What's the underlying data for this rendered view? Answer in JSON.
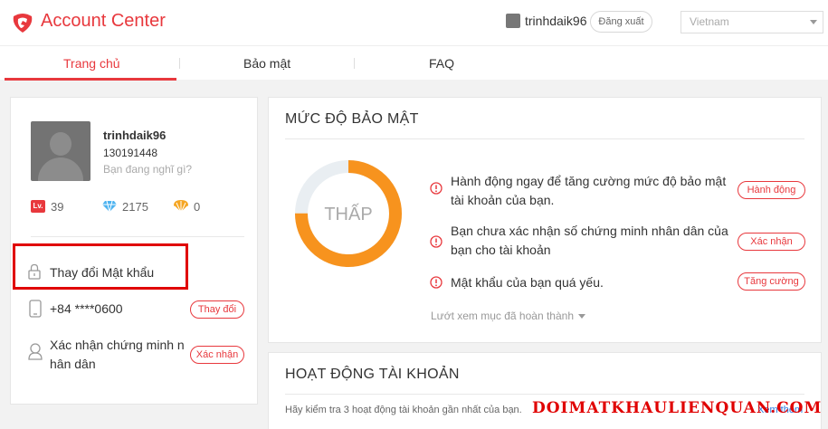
{
  "header": {
    "brand": "Account Center",
    "username": "trinhdaik96",
    "logout_label": "Đăng xuất",
    "region": "Vietnam"
  },
  "nav": {
    "tabs": [
      {
        "label": "Trang chủ",
        "active": true
      },
      {
        "label": "Bảo mật",
        "active": false
      },
      {
        "label": "FAQ",
        "active": false
      }
    ]
  },
  "profile": {
    "name": "trinhdaik96",
    "id": "130191448",
    "status_placeholder": "Bạn đang nghĩ gì?",
    "level_badge": "Lv.",
    "level": "39",
    "diamonds": "2175",
    "shells": "0",
    "change_password": "Thay đổi Mật khẩu",
    "phone": "+84 ****0600",
    "phone_action": "Thay đổi",
    "id_verify_line1": "Xác nhận chứng minh n",
    "id_verify_line2": "hân dân",
    "id_verify_action": "Xác nhận"
  },
  "security": {
    "title": "MỨC ĐỘ BẢO MẬT",
    "level_label": "THẤP",
    "level_fraction": 0.75,
    "issues": [
      {
        "line1": "Hành động ngay để tăng cường mức độ bảo mật",
        "line2": "tài khoản của bạn.",
        "action": "Hành động"
      },
      {
        "line1": "Bạn chưa xác nhận số chứng minh nhân dân của",
        "line2": "bạn cho tài khoản",
        "action": "Xác nhận"
      },
      {
        "line1": "Mật khẩu của bạn quá yếu.",
        "line2": "",
        "action": "Tăng cường"
      }
    ],
    "more_label": "Lướt xem mục đã hoàn thành",
    "accent": "#f7931e",
    "track": "#e9eef2"
  },
  "activity": {
    "title": "HOẠT ĐỘNG TÀI KHOẢN",
    "description": "Hãy kiểm tra 3 hoạt động tài khoản gần nhất của bạn.",
    "link": "Xem thêm"
  },
  "watermark": "DOIMATKHAULIENQUAN.COM",
  "colors": {
    "brand": "#e8383d",
    "highlight": "#e00000"
  }
}
